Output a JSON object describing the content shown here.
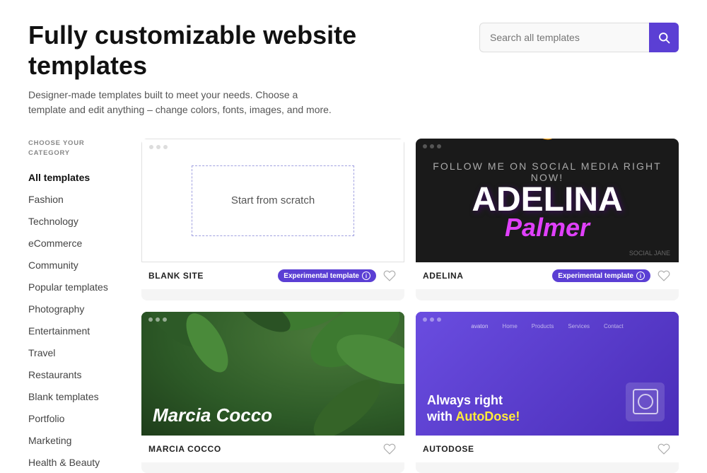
{
  "header": {
    "title": "Fully customizable website templates",
    "subtitle": "Designer-made templates built to meet your needs. Choose a template and edit anything – change colors, fonts, images, and more.",
    "search": {
      "placeholder": "Search all templates",
      "button_label": "Search"
    }
  },
  "sidebar": {
    "category_label": "CHOOSE YOUR CATEGORY",
    "items": [
      {
        "id": "all-templates",
        "label": "All templates",
        "active": true
      },
      {
        "id": "fashion",
        "label": "Fashion",
        "active": false
      },
      {
        "id": "technology",
        "label": "Technology",
        "active": false
      },
      {
        "id": "ecommerce",
        "label": "eCommerce",
        "active": false
      },
      {
        "id": "community",
        "label": "Community",
        "active": false
      },
      {
        "id": "popular-templates",
        "label": "Popular templates",
        "active": false
      },
      {
        "id": "photography",
        "label": "Photography",
        "active": false
      },
      {
        "id": "entertainment",
        "label": "Entertainment",
        "active": false
      },
      {
        "id": "travel",
        "label": "Travel",
        "active": false
      },
      {
        "id": "restaurants",
        "label": "Restaurants",
        "active": false
      },
      {
        "id": "blank-templates",
        "label": "Blank templates",
        "active": false
      },
      {
        "id": "portfolio",
        "label": "Portfolio",
        "active": false
      },
      {
        "id": "marketing",
        "label": "Marketing",
        "active": false
      },
      {
        "id": "health-beauty",
        "label": "Health & Beauty",
        "active": false
      }
    ]
  },
  "templates": {
    "cards": [
      {
        "id": "blank-site",
        "name": "BLANK SITE",
        "badge": "Experimental template",
        "type": "blank",
        "start_text": "Start from scratch"
      },
      {
        "id": "adelina",
        "name": "ADELINA",
        "badge": "Experimental template",
        "type": "adelina",
        "main_text": "ADELINA",
        "sub_text": "Palmer"
      },
      {
        "id": "marcia-cocco",
        "name": "MARCIA COCCO",
        "badge": "",
        "type": "marcia",
        "main_text": "Marcia Cocco"
      },
      {
        "id": "autodose",
        "name": "AUTODOSE",
        "badge": "",
        "type": "autodose",
        "line1": "Always right",
        "line2": "with AutoDose!"
      }
    ]
  },
  "colors": {
    "accent": "#5b3fd4",
    "badge_bg": "#5b3fd4",
    "badge_text": "#ffffff"
  }
}
